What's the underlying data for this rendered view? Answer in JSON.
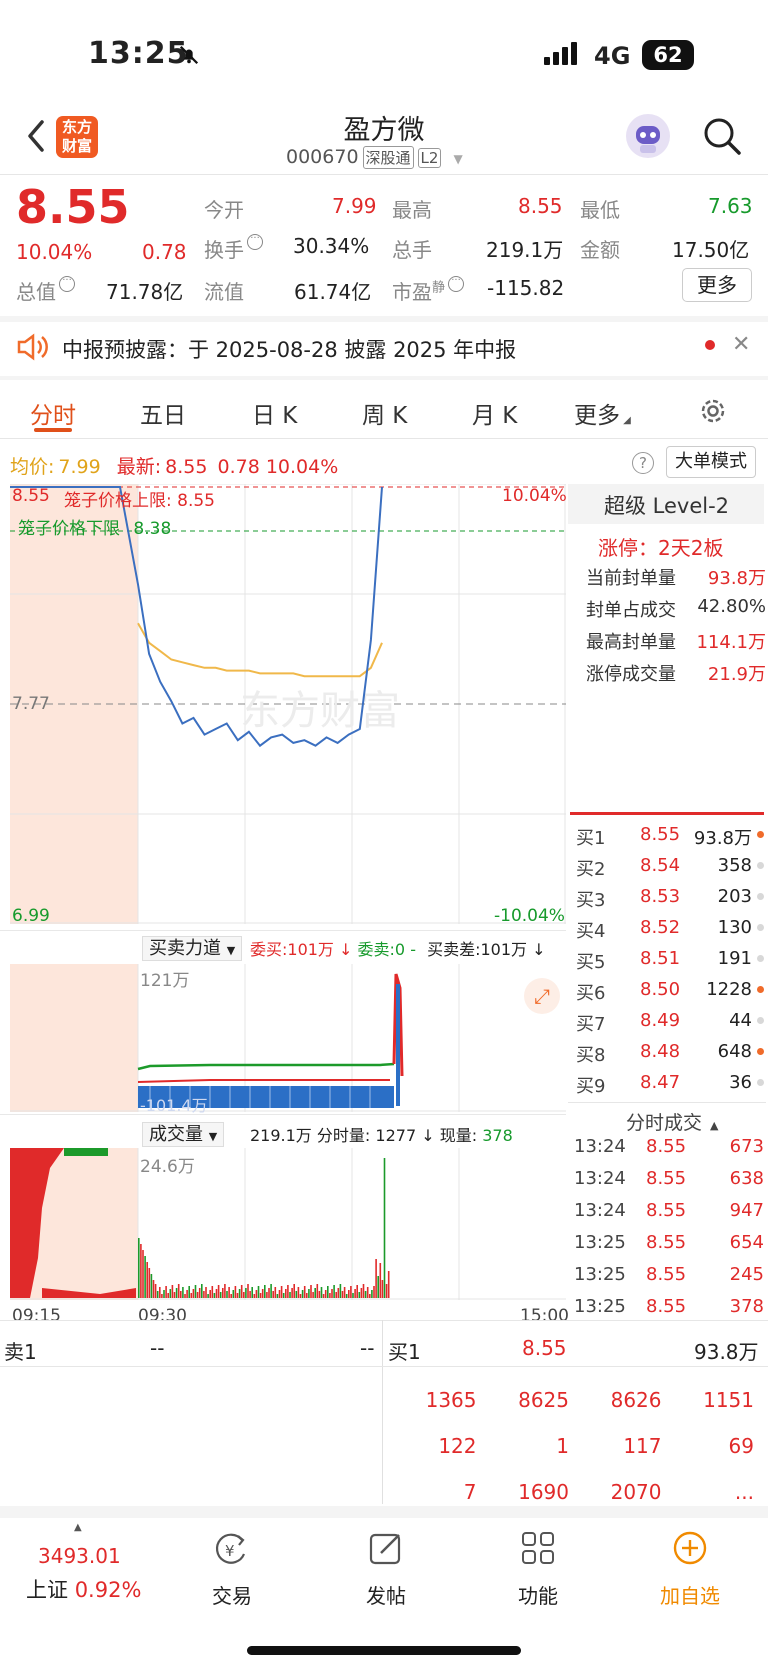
{
  "status": {
    "time": "13:25",
    "network": "4G",
    "battery": "62"
  },
  "header": {
    "title": "盈方微",
    "code": "000670",
    "tag1": "深股通",
    "tag2": "L2",
    "logo_line1": "东方",
    "logo_line2": "财富"
  },
  "quote": {
    "price": "8.55",
    "change_pct": "10.04%",
    "change": "0.78",
    "open_label": "今开",
    "open": "7.99",
    "high_label": "最高",
    "high": "8.55",
    "low_label": "最低",
    "low": "7.63",
    "turnover_label": "换手",
    "turnover": "30.34%",
    "volume_label": "总手",
    "volume": "219.1万",
    "amount_label": "金额",
    "amount": "17.50亿",
    "mktcap_label": "总值",
    "mktcap": "71.78亿",
    "float_label": "流值",
    "float": "61.74亿",
    "pe_label": "市盈",
    "pe_sup": "静",
    "pe": "-115.82",
    "more": "更多"
  },
  "notice": {
    "text": "中报预披露：于 2025-08-28 披露 2025 年中报"
  },
  "tabs": [
    "分时",
    "五日",
    "日 K",
    "周 K",
    "月 K",
    "更多"
  ],
  "chart_info": {
    "avg_label": "均价:",
    "avg": "7.99",
    "latest_label": "最新:",
    "latest": "8.55",
    "latest_change": "0.78",
    "latest_pct": "10.04%",
    "big_order": "大单模式",
    "price_top": "8.55",
    "price_bottom": "6.99",
    "pct_top": "10.04%",
    "pct_bottom": "-10.04%",
    "prev_close": "7.77",
    "cage_upper_label": "笼子价格上限",
    "cage_upper": "8.55",
    "cage_lower_label": "笼子价格下限",
    "cage_lower": "8.38",
    "force_label": "买卖力道",
    "force_buy": "委买:101万",
    "force_sell": "委卖:0",
    "force_sep": "-",
    "force_diff": "买卖差:101万",
    "force_max": "121万",
    "force_min": "-101.4万",
    "vol_label": "成交量",
    "vol_total": "219.1万",
    "vol_min_label": "分时量:",
    "vol_min": "1277",
    "vol_now_label": "现量:",
    "vol_now": "378",
    "vol_max": "24.6万",
    "t_start": "09:15",
    "t_open": "09:30",
    "t_end": "15:00"
  },
  "chart_data": {
    "type": "line",
    "series": [
      {
        "name": "最新",
        "values": [
          8.55,
          8.55,
          8.55,
          8.2,
          7.95,
          7.85,
          7.78,
          7.7,
          7.72,
          7.66,
          7.68,
          7.7,
          7.64,
          7.67,
          7.62,
          7.65,
          7.66,
          7.63,
          7.64,
          7.62,
          7.65,
          7.63,
          7.66,
          7.68,
          8.0,
          8.55
        ]
      },
      {
        "name": "均价",
        "values": [
          null,
          null,
          null,
          8.06,
          7.99,
          7.96,
          7.93,
          7.92,
          7.91,
          7.9,
          7.9,
          7.89,
          7.89,
          7.89,
          7.88,
          7.88,
          7.88,
          7.88,
          7.87,
          7.87,
          7.87,
          7.87,
          7.87,
          7.87,
          7.9,
          7.99
        ]
      }
    ],
    "ylim": [
      6.99,
      8.55
    ]
  },
  "level2": {
    "title": "超级 Level-2",
    "limit_up": "涨停：2天2板",
    "rows": [
      {
        "label": "当前封单量",
        "value": "93.8万"
      },
      {
        "label": "封单占成交",
        "value": "42.80%"
      },
      {
        "label": "最高封单量",
        "value": "114.1万"
      },
      {
        "label": "涨停成交量",
        "value": "21.9万"
      }
    ]
  },
  "orderbook": [
    {
      "label": "买1",
      "price": "8.55",
      "vol": "93.8万",
      "dot": "#f06b2a"
    },
    {
      "label": "买2",
      "price": "8.54",
      "vol": "358",
      "dot": "#d8d8d8"
    },
    {
      "label": "买3",
      "price": "8.53",
      "vol": "203",
      "dot": "#d8d8d8"
    },
    {
      "label": "买4",
      "price": "8.52",
      "vol": "130",
      "dot": "#d8d8d8"
    },
    {
      "label": "买5",
      "price": "8.51",
      "vol": "191",
      "dot": "#d8d8d8"
    },
    {
      "label": "买6",
      "price": "8.50",
      "vol": "1228",
      "dot": "#f06b2a"
    },
    {
      "label": "买7",
      "price": "8.49",
      "vol": "44",
      "dot": "#d8d8d8"
    },
    {
      "label": "买8",
      "price": "8.48",
      "vol": "648",
      "dot": "#f06b2a"
    },
    {
      "label": "买9",
      "price": "8.47",
      "vol": "36",
      "dot": "#d8d8d8"
    }
  ],
  "ticks_title": "分时成交",
  "ticks": [
    {
      "time": "13:24",
      "price": "8.55",
      "vol": "673"
    },
    {
      "time": "13:24",
      "price": "8.55",
      "vol": "638"
    },
    {
      "time": "13:24",
      "price": "8.55",
      "vol": "947"
    },
    {
      "time": "13:25",
      "price": "8.55",
      "vol": "654"
    },
    {
      "time": "13:25",
      "price": "8.55",
      "vol": "245"
    },
    {
      "time": "13:25",
      "price": "8.55",
      "vol": "378"
    }
  ],
  "bottom": {
    "sell1_label": "卖1",
    "sell1_price": "--",
    "sell1_vol": "--",
    "buy1_label": "买1",
    "buy1_price": "8.55",
    "buy1_vol": "93.8万",
    "queue": [
      [
        "1365",
        "8625",
        "8626",
        "1151"
      ],
      [
        "122",
        "1",
        "117",
        "69"
      ],
      [
        "7",
        "1690",
        "2070",
        "..."
      ]
    ]
  },
  "nav": {
    "index_value": "3493.01",
    "index_name": "上证",
    "index_pct": "0.92%",
    "items": [
      "交易",
      "发帖",
      "功能",
      "加自选"
    ]
  }
}
